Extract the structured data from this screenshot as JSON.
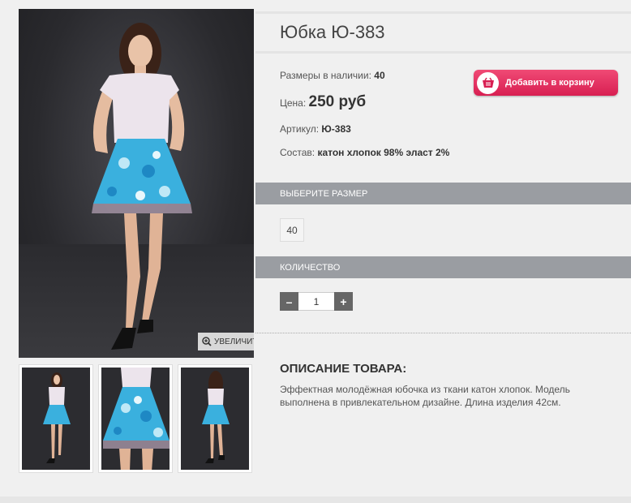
{
  "product": {
    "title": "Юбка Ю-383",
    "sizes_label": "Размеры в наличии:",
    "sizes_value": "40",
    "price_label": "Цена:",
    "price_value": "250 руб",
    "sku_label": "Артикул:",
    "sku_value": "Ю-383",
    "composition_label": "Состав:",
    "composition_value": "катон хлопок 98% эласт 2%"
  },
  "gallery": {
    "zoom_label": "УВЕЛИЧИТЬ",
    "zoom_icon": "zoom-in-icon",
    "thumbnails": [
      "front",
      "skirt-closeup",
      "back"
    ]
  },
  "cart": {
    "button_label": "Добавить в корзину",
    "icon": "basket-icon"
  },
  "size_section": {
    "header": "ВЫБЕРИТЕ РАЗМЕР",
    "options": [
      "40"
    ]
  },
  "quantity_section": {
    "header": "КОЛИЧЕСТВО",
    "minus": "–",
    "plus": "+",
    "value": "1"
  },
  "description": {
    "title": "ОПИСАНИЕ ТОВАРА:",
    "text": "Эффектная молодёжная юбочка из ткани катон хлопок. Модель выполнена в привлекательном дизайне. Длина изделия 42см."
  },
  "colors": {
    "accent": "#e0245e",
    "section_bar": "#9a9da2",
    "background": "#f0f0f0"
  }
}
